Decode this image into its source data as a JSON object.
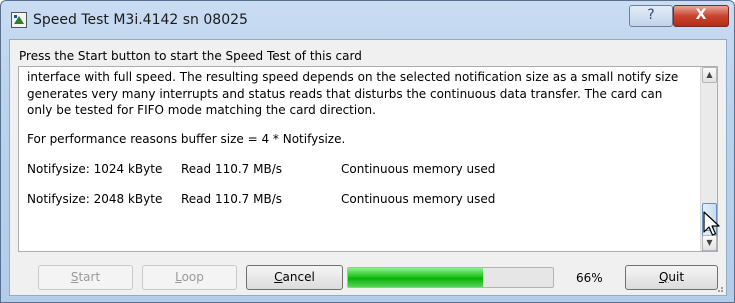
{
  "window": {
    "title": "Speed Test M3i.4142 sn 08025",
    "help_icon": "?",
    "close_icon": "X"
  },
  "instruction": "Press the Start button to start the Speed Test of this card",
  "log": {
    "paragraph1": "interface with full speed. The resulting speed depends on the selected notification size as a small notify size generates very many interrupts and status reads that disturbs the continuous data transfer. The card can only be tested for FIFO mode matching the card direction.",
    "paragraph2": "For performance reasons buffer size = 4 * Notifysize.",
    "rows": [
      {
        "notify": "Notifysize: 1024 kByte",
        "read": "Read 110.7 MB/s",
        "memory": "Continuous memory used"
      },
      {
        "notify": "Notifysize: 2048 kByte",
        "read": "Read 110.7 MB/s",
        "memory": "Continuous memory used"
      }
    ]
  },
  "buttons": {
    "start": "Start",
    "loop": "Loop",
    "cancel": "Cancel",
    "quit": "Quit"
  },
  "progress": {
    "value": 0.66,
    "label": "66%"
  },
  "colors": {
    "progress_green": "#07b207",
    "titlebar": "#bcd3ee",
    "close_red": "#c8442f"
  },
  "icons": {
    "app": "app-icon",
    "scroll_up": "up-arrow-icon",
    "scroll_down": "down-arrow-icon",
    "cursor": "mouse-pointer-icon"
  }
}
